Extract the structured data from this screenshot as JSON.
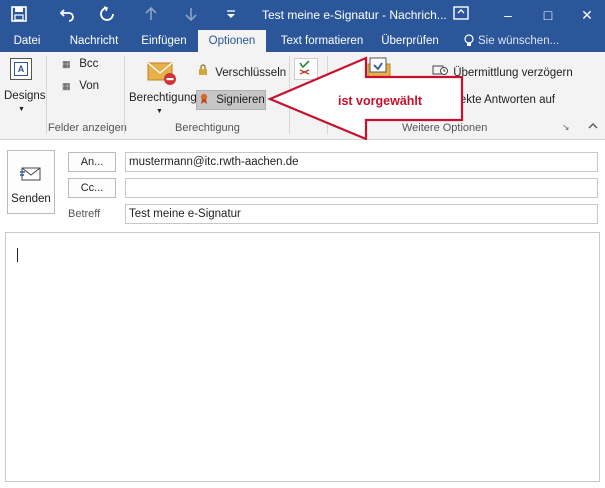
{
  "titlebar": {
    "title": "Test meine e-Signatur - Nachrich...",
    "save_icon": "save-icon",
    "undo_icon": "undo-icon",
    "redo_icon": "redo-icon",
    "up_icon": "arrow-up-icon",
    "down_icon": "arrow-down-icon",
    "more_icon": "customize-icon",
    "window": {
      "ribbon_icon": "ribbon-display-icon",
      "minimize": "–",
      "maximize": "□",
      "close": "✕"
    }
  },
  "tabs": [
    {
      "label": "Datei"
    },
    {
      "label": "Nachricht"
    },
    {
      "label": "Einfügen"
    },
    {
      "label": "Optionen"
    },
    {
      "label": "Text formatieren"
    },
    {
      "label": "Überprüfen"
    },
    {
      "label": "Sie wünschen..."
    }
  ],
  "active_tab": "Optionen",
  "ribbon": {
    "designs_label": "Designs",
    "bcc_label": "Bcc",
    "von_label": "Von",
    "felder_group": "Felder anzeigen",
    "berechtigung_label": "Berechtigung",
    "verschluesseln_label": "Verschlüsseln",
    "signieren_label": "Signieren",
    "berechtigung_group": "Berechtigung",
    "voting_label": "V",
    "uebermittlung_label": "Übermittlung verzögern",
    "direkte_label": "rekte Antworten auf",
    "weitere_group": "Weitere Optionen"
  },
  "callout": {
    "text": "ist vorgewählt",
    "color": "#c8102e"
  },
  "compose": {
    "send_label": "Senden",
    "to_button": "An...",
    "cc_button": "Cc...",
    "subject_label": "Betreff",
    "to_value": "mustermann@itc.rwth-aachen.de",
    "cc_value": "",
    "subject_value": "Test meine e-Signatur",
    "body": ""
  },
  "colors": {
    "accent": "#2b579a",
    "ribbon_bg": "#f3f3f3"
  }
}
